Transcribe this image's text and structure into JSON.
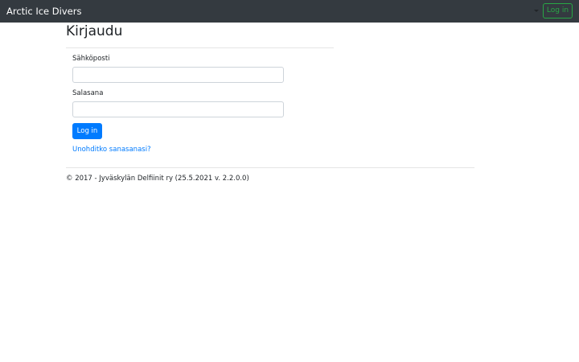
{
  "navbar": {
    "brand": "Arctic Ice Divers",
    "login_button": "Log in",
    "colors": {
      "background": "#343a40",
      "login_accent": "#28a745"
    }
  },
  "page": {
    "title": "Kirjaudu"
  },
  "login_form": {
    "email_label": "Sähköposti",
    "email_value": "",
    "password_label": "Salasana",
    "password_value": "",
    "submit_label": "Log in",
    "forgot_password_link": "Unohditko sanasanasi?",
    "colors": {
      "primary": "#007bff"
    }
  },
  "footer": {
    "text": "© 2017 - Jyväskylän Delfiinit ry (25.5.2021 v. 2.2.0.0)"
  }
}
